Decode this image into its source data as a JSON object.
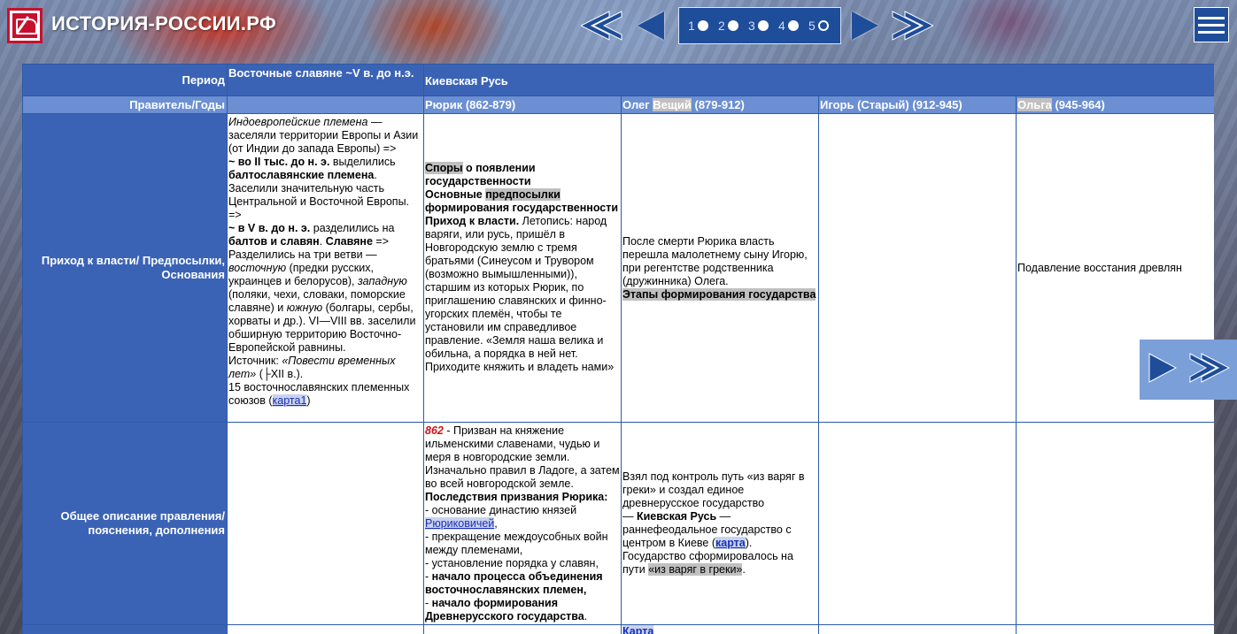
{
  "site": {
    "title": "ИСТОРИЯ-РОССИИ.РФ"
  },
  "pagination": {
    "pages": [
      {
        "label": "1",
        "active": false
      },
      {
        "label": "2",
        "active": false
      },
      {
        "label": "3",
        "active": false
      },
      {
        "label": "4",
        "active": false
      },
      {
        "label": "5",
        "active": true
      }
    ]
  },
  "colors": {
    "header_blue": "#3b63b5",
    "ruler_blue": "#6b8fd2",
    "nav_blue": "#1e4d9a",
    "date_red": "#d01414"
  },
  "table": {
    "row_labels": {
      "period": "Период",
      "rulers": "Правитель/Годы",
      "arrival": "Приход к власти/ Предпосылки, Основания",
      "description": "Общее описание правления/ пояснения, дополнения"
    },
    "periods": {
      "slavs": "Восточные славяне ~V в. до н.э.",
      "kievan": "Киевская Русь"
    },
    "rulers": {
      "rurik": "Рюрик (862-879)",
      "oleg_pre": "Олег ",
      "oleg_hl": "Вещий",
      "oleg_post": " (879-912)",
      "igor": "Игорь (Старый) (912-945)",
      "olga_hl": "Ольга",
      "olga_post": " (945-964)"
    },
    "slavs_arrival": {
      "p1_italic": "Индоевропейские племена",
      "p1_rest": " — заселяли территории Европы и Азии (от Индии до запада Европы) =>",
      "p2_bold": "~ во II тыс. до н. э.",
      "p2_mid": " выделились ",
      "p2_bold2": "балтославянские племена",
      "p2_rest": ". Заселили значительную часть Центральной и Восточной Европы. =>",
      "p3_bold": "~ в V в. до н. э.",
      "p3_mid": " разделились на ",
      "p3_bold2": "балтов и славян",
      "p3_mid2": ". ",
      "p3_bold3": "Славяне",
      "p3_mid3": " => Разделились на три ветви — ",
      "p3_it1": "восточную",
      "p3_mid4": " (предки русских, украинцев и белорусов), ",
      "p3_it2": "западную",
      "p3_mid5": " (поляки, чехи, словаки, поморские славяне) и ",
      "p3_it3": "южную",
      "p3_rest": " (болгары, сербы, хорваты и др.). VI—VIII вв. заселили обширную территорию Восточно-Европейской равнины.",
      "p4_pre": "Источник: ",
      "p4_it": "«Повести временных лет»",
      "p4_rest": " (├XII в.).",
      "p5_pre": "15 восточнославянских племенных союзов (",
      "p5_link": "карта1",
      "p5_post": ")"
    },
    "rurik_arrival": {
      "a_hl": "Споры",
      "a_rest": " о появлении государственности",
      "b_pre": "Основные ",
      "b_hl": "предпосылки",
      "b_rest": " формирования государственности",
      "c_bold": "Приход к власти.",
      "c_rest": " Летопись: народ варяги, или русь, пришёл в Новгородскую землю с тремя братьями (Синеусом и Трувором (возможно вымышленными)), старшим из которых Рюрик, по приглашению славянских и финно-угорских племён, чтобы те установили им справедливое правление. «Земля наша велика и обильна, а порядка в ней нет. Приходите княжить и владеть нами»"
    },
    "oleg_arrival": {
      "text": "После смерти Рюрика власть перешла малолетнему сыну Игорю, при регентстве родственника (дружинника) Олега.",
      "stages_hl": "Этапы формирования государства"
    },
    "olga_arrival": {
      "text": "Подавление восстания древлян"
    },
    "rurik_desc": {
      "date": "862",
      "intro": " - Призван на княжение ильменскими славенами, чудью и меря в новгородские земли. Изначально правил в Ладоге, а затем во всей новгородской земле.",
      "cons_title": "Последствия призвания Рюрика:",
      "c1_pre": "- основание династию князей ",
      "c1_link": "Рюриковичей",
      "c1_post": ",",
      "c2": "- прекращение междоусобных войн между племенами,",
      "c3": "- установление порядка у славян,",
      "c4_pre": "- ",
      "c4_bold": "начало процесса объединения восточнославянских племен,",
      "c5_pre": "- ",
      "c5_bold": "начало формирования Древнерусского государства",
      "c5_post": "."
    },
    "oleg_desc": {
      "p1": "Взял под контроль путь «из варяг в греки» и создал единое древнерусское государство",
      "p2_pre": "— ",
      "p2_bold": "Киевская Русь",
      "p2_mid": " — раннефеодальное государство с центром в Киеве (",
      "p2_link": "карта",
      "p2_post": ").",
      "p3_pre": "Государство сформировалось на пути ",
      "p3_hl": "«из варяг в греки»",
      "p3_post": "."
    },
    "next_row": {
      "oleg_link": "Карта"
    }
  }
}
